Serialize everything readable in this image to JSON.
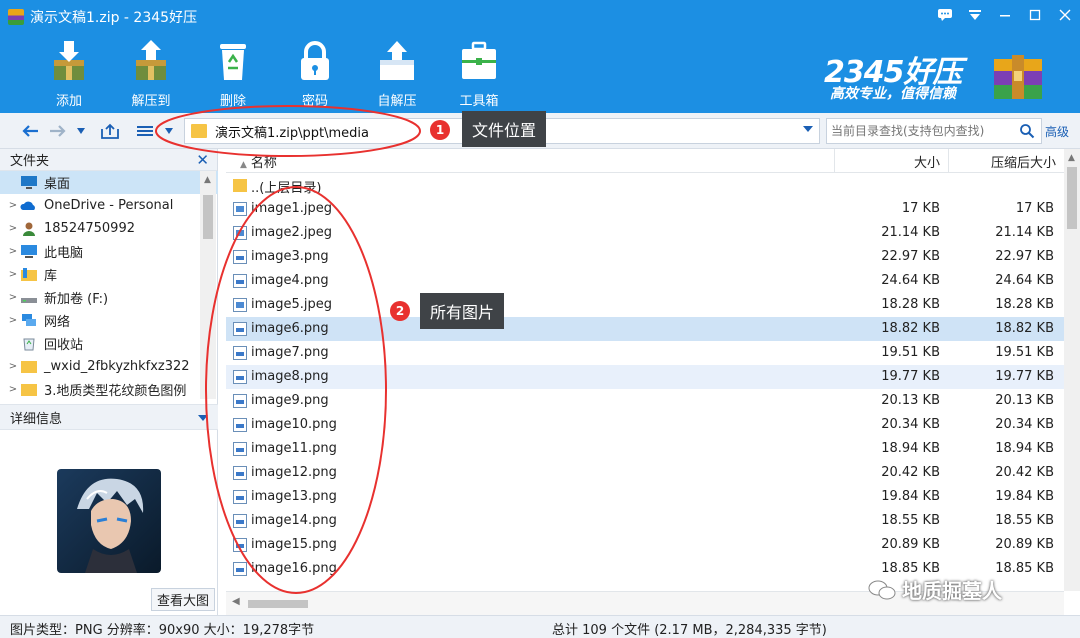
{
  "window": {
    "title": "演示文稿1.zip - 2345好压"
  },
  "toolbar": {
    "items": [
      {
        "label": "添加",
        "icon": "add-archive-icon"
      },
      {
        "label": "解压到",
        "icon": "extract-to-icon"
      },
      {
        "label": "删除",
        "icon": "recycle-bin-icon"
      },
      {
        "label": "密码",
        "icon": "lock-icon"
      },
      {
        "label": "自解压",
        "icon": "self-extract-icon"
      },
      {
        "label": "工具箱",
        "icon": "toolbox-icon"
      }
    ]
  },
  "brand": {
    "name": "2345好压",
    "slogan": "高效专业，值得信赖"
  },
  "navbar": {
    "path": "演示文稿1.zip\\ppt\\media",
    "search_placeholder": "当前目录查找(支持包内查找)",
    "advanced_label": "高级"
  },
  "left_panel": {
    "header": "文件夹",
    "tree": [
      {
        "label": "桌面",
        "icon": "desktop-icon",
        "selected": true
      },
      {
        "label": "OneDrive - Personal",
        "icon": "onedrive-cloud-icon"
      },
      {
        "label": "18524750992",
        "icon": "user-icon"
      },
      {
        "label": "此电脑",
        "icon": "computer-icon"
      },
      {
        "label": "库",
        "icon": "library-icon"
      },
      {
        "label": "新加卷 (F:)",
        "icon": "drive-icon"
      },
      {
        "label": "网络",
        "icon": "network-icon"
      },
      {
        "label": "回收站",
        "icon": "recycle-bin-icon"
      },
      {
        "label": "_wxid_2fbkyzhkfxz322",
        "icon": "folder-icon"
      },
      {
        "label": "3.地质类型花纹颜色图例",
        "icon": "folder-icon"
      }
    ],
    "details_header": "详细信息",
    "view_large_label": "查看大图"
  },
  "file_list": {
    "columns": {
      "name": "名称",
      "size": "大小",
      "compressed": "压缩后大小"
    },
    "rows": [
      {
        "name": "..(上层目录)",
        "size": "",
        "compressed": "",
        "type": "folder"
      },
      {
        "name": "image1.jpeg",
        "size": "17 KB",
        "compressed": "17 KB",
        "type": "jpeg"
      },
      {
        "name": "image2.jpeg",
        "size": "21.14 KB",
        "compressed": "21.14 KB",
        "type": "jpeg"
      },
      {
        "name": "image3.png",
        "size": "22.97 KB",
        "compressed": "22.97 KB",
        "type": "png"
      },
      {
        "name": "image4.png",
        "size": "24.64 KB",
        "compressed": "24.64 KB",
        "type": "png"
      },
      {
        "name": "image5.jpeg",
        "size": "18.28 KB",
        "compressed": "18.28 KB",
        "type": "jpeg"
      },
      {
        "name": "image6.png",
        "size": "18.82 KB",
        "compressed": "18.82 KB",
        "type": "png",
        "selected": true
      },
      {
        "name": "image7.png",
        "size": "19.51 KB",
        "compressed": "19.51 KB",
        "type": "png"
      },
      {
        "name": "image8.png",
        "size": "19.77 KB",
        "compressed": "19.77 KB",
        "type": "png",
        "alt": true
      },
      {
        "name": "image9.png",
        "size": "20.13 KB",
        "compressed": "20.13 KB",
        "type": "png"
      },
      {
        "name": "image10.png",
        "size": "20.34 KB",
        "compressed": "20.34 KB",
        "type": "png"
      },
      {
        "name": "image11.png",
        "size": "18.94 KB",
        "compressed": "18.94 KB",
        "type": "png"
      },
      {
        "name": "image12.png",
        "size": "20.42 KB",
        "compressed": "20.42 KB",
        "type": "png"
      },
      {
        "name": "image13.png",
        "size": "19.84 KB",
        "compressed": "19.84 KB",
        "type": "png"
      },
      {
        "name": "image14.png",
        "size": "18.55 KB",
        "compressed": "18.55 KB",
        "type": "png"
      },
      {
        "name": "image15.png",
        "size": "20.89 KB",
        "compressed": "20.89 KB",
        "type": "png"
      },
      {
        "name": "image16.png",
        "size": "18.85 KB",
        "compressed": "18.85 KB",
        "type": "png"
      }
    ]
  },
  "status": {
    "left": "图片类型：PNG 分辨率：90x90 大小：19,278字节",
    "center": "总计 109 个文件 (2.17 MB，2,284,335 字节)"
  },
  "annotations": {
    "callout1": {
      "number": "1",
      "text": "文件位置"
    },
    "callout2": {
      "number": "2",
      "text": "所有图片"
    },
    "color": "#e8312f"
  },
  "watermark": "地质掘墓人",
  "colors": {
    "accent": "#1c8fe3",
    "selection": "#cfe3f6",
    "annotation_red": "#e8312f"
  }
}
